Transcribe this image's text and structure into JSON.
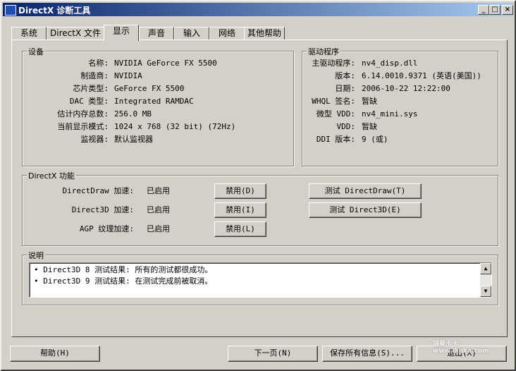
{
  "window": {
    "title": "DirectX 诊断工具",
    "min": "_",
    "max": "□",
    "close": "×"
  },
  "tabs": [
    "系统",
    "DirectX 文件",
    "显示",
    "声音",
    "输入",
    "网络",
    "其他帮助"
  ],
  "device": {
    "legend": "设备",
    "rows": [
      {
        "label": "名称:",
        "value": "NVIDIA GeForce FX 5500"
      },
      {
        "label": "制造商:",
        "value": "NVIDIA"
      },
      {
        "label": "芯片类型:",
        "value": "GeForce FX 5500"
      },
      {
        "label": "DAC 类型:",
        "value": "Integrated RAMDAC"
      },
      {
        "label": "估计内存总数:",
        "value": "256.0 MB"
      },
      {
        "label": "当前显示模式:",
        "value": "1024 x 768 (32 bit) (72Hz)"
      },
      {
        "label": "监视器:",
        "value": "默认监视器"
      }
    ]
  },
  "driver": {
    "legend": "驱动程序",
    "rows": [
      {
        "label": "主驱动程序:",
        "value": "nv4_disp.dll"
      },
      {
        "label": "版本:",
        "value": "6.14.0010.9371 (英语(美国))"
      },
      {
        "label": "日期:",
        "value": "2006-10-22 12:22:00"
      },
      {
        "label": "WHQL 签名:",
        "value": "暂缺"
      },
      {
        "label": "微型 VDD:",
        "value": "nv4_mini.sys"
      },
      {
        "label": "VDD:",
        "value": "暂缺"
      },
      {
        "label": "DDI 版本:",
        "value": "9 (或)"
      }
    ]
  },
  "features": {
    "legend": "DirectX 功能",
    "rows": [
      {
        "label": "DirectDraw 加速:",
        "status": "已启用",
        "disable": "禁用(D)",
        "test": "测试 DirectDraw(T)"
      },
      {
        "label": "Direct3D 加速:",
        "status": "已启用",
        "disable": "禁用(I)",
        "test": "测试 Direct3D(E)"
      },
      {
        "label": "AGP 纹理加速:",
        "status": "已启用",
        "disable": "禁用(L)"
      }
    ]
  },
  "notes": {
    "legend": "说明",
    "lines": [
      "• Direct3D 8 测试结果: 所有的测试都很成功。",
      "• Direct3D 9 测试结果: 在测试完成前被取消。"
    ]
  },
  "footer": {
    "help": "帮助(H)",
    "next": "下一页(N)",
    "save": "保存所有信息(S)...",
    "exit": "退出(X)"
  },
  "watermark": "瑞星卡卡 www.ikaka.com"
}
